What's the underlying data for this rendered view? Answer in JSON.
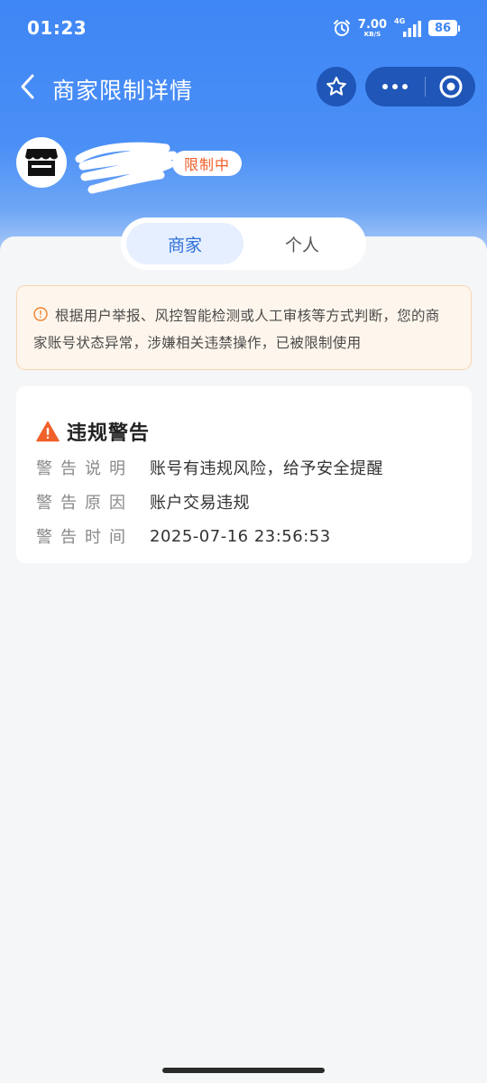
{
  "status_bar": {
    "time": "01:23",
    "net_speed_value": "7.00",
    "net_speed_unit": "KB/S",
    "signal_label": "4G",
    "battery": "86"
  },
  "header": {
    "title": "商家限制详情",
    "status_badge": "限制中"
  },
  "tabs": [
    {
      "label": "商家",
      "active": true
    },
    {
      "label": "个人",
      "active": false
    }
  ],
  "notice": {
    "text": "根据用户举报、风控智能检测或人工审核等方式判断，您的商家账号状态异常，涉嫌相关违禁操作，已被限制使用"
  },
  "warning_card": {
    "title": "违规警告",
    "rows": [
      {
        "label": "警告说明",
        "value": "账号有违规风险，给予安全提醒"
      },
      {
        "label": "警告原因",
        "value": "账户交易违规"
      },
      {
        "label": "警告时间",
        "value": "2025-07-16 23:56:53"
      }
    ]
  },
  "colors": {
    "header_blue": "#3f86f5",
    "capsule_blue": "#1f56b8",
    "tab_active_text": "#2e6fd8",
    "badge_text": "#f0612a",
    "warning_icon": "#f0612a",
    "notice_bg": "#fef6ec"
  },
  "icons": {
    "back": "chevron-left-icon",
    "favorite": "star-outline-icon",
    "more": "more-dots-icon",
    "close_miniprogram": "target-circle-icon",
    "avatar": "storefront-icon",
    "notice": "info-circle-icon",
    "warning": "warning-triangle-icon"
  }
}
